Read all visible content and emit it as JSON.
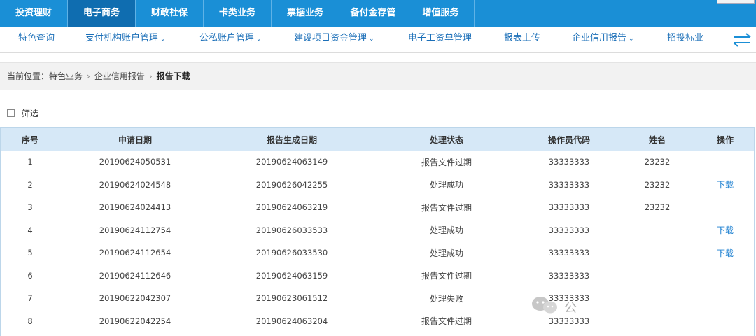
{
  "top_nav": {
    "tabs": [
      {
        "label": "投资理财",
        "active": false
      },
      {
        "label": "电子商务",
        "active": true
      },
      {
        "label": "财政社保",
        "active": false
      },
      {
        "label": "卡类业务",
        "active": false
      },
      {
        "label": "票据业务",
        "active": false
      },
      {
        "label": "备付金存管",
        "active": false
      },
      {
        "label": "增值服务",
        "active": false
      }
    ]
  },
  "sub_nav": {
    "items": [
      {
        "label": "特色查询",
        "dropdown": false
      },
      {
        "label": "支付机构账户管理",
        "dropdown": true
      },
      {
        "label": "公私账户管理",
        "dropdown": true
      },
      {
        "label": "建设项目资金管理",
        "dropdown": true
      },
      {
        "label": "电子工资单管理",
        "dropdown": false
      },
      {
        "label": "报表上传",
        "dropdown": false
      },
      {
        "label": "企业信用报告",
        "dropdown": true
      },
      {
        "label": "招投标业",
        "dropdown": false
      }
    ],
    "chevron": "⌄",
    "swap_icon": "swap-arrows-icon"
  },
  "breadcrumb": {
    "prefix": "当前位置：",
    "items": [
      "特色业务",
      "企业信用报告",
      "报告下载"
    ],
    "separator": "›"
  },
  "filter": {
    "label": "筛选",
    "checked": false
  },
  "table": {
    "headers": [
      "序号",
      "申请日期",
      "报告生成日期",
      "处理状态",
      "操作员代码",
      "姓名",
      "操作"
    ],
    "rows": [
      {
        "no": "1",
        "apply_date": "20190624050531",
        "gen_date": "20190624063149",
        "status": "报告文件过期",
        "operator": "33333333",
        "name": "23232",
        "action": ""
      },
      {
        "no": "2",
        "apply_date": "20190624024548",
        "gen_date": "20190626042255",
        "status": "处理成功",
        "operator": "33333333",
        "name": "23232",
        "action": "下载"
      },
      {
        "no": "3",
        "apply_date": "20190624024413",
        "gen_date": "20190624063219",
        "status": "报告文件过期",
        "operator": "33333333",
        "name": "23232",
        "action": ""
      },
      {
        "no": "4",
        "apply_date": "20190624112754",
        "gen_date": "20190626033533",
        "status": "处理成功",
        "operator": "33333333",
        "name": "",
        "action": "下载"
      },
      {
        "no": "5",
        "apply_date": "20190624112654",
        "gen_date": "20190626033530",
        "status": "处理成功",
        "operator": "33333333",
        "name": "",
        "action": "下载"
      },
      {
        "no": "6",
        "apply_date": "20190624112646",
        "gen_date": "20190624063159",
        "status": "报告文件过期",
        "operator": "33333333",
        "name": "",
        "action": ""
      },
      {
        "no": "7",
        "apply_date": "20190622042307",
        "gen_date": "20190623061512",
        "status": "处理失败",
        "operator": "33333333",
        "name": "",
        "action": ""
      },
      {
        "no": "8",
        "apply_date": "20190622042254",
        "gen_date": "20190624063204",
        "status": "报告文件过期",
        "operator": "33333333",
        "name": "",
        "action": ""
      }
    ]
  },
  "watermark": {
    "icon": "wechat-icon",
    "text": "公"
  },
  "colors": {
    "top_nav_bg": "#1a8fd6",
    "top_nav_active": "#0f6db0",
    "link": "#1b6fb8",
    "table_header_bg": "#d6e8f7"
  }
}
